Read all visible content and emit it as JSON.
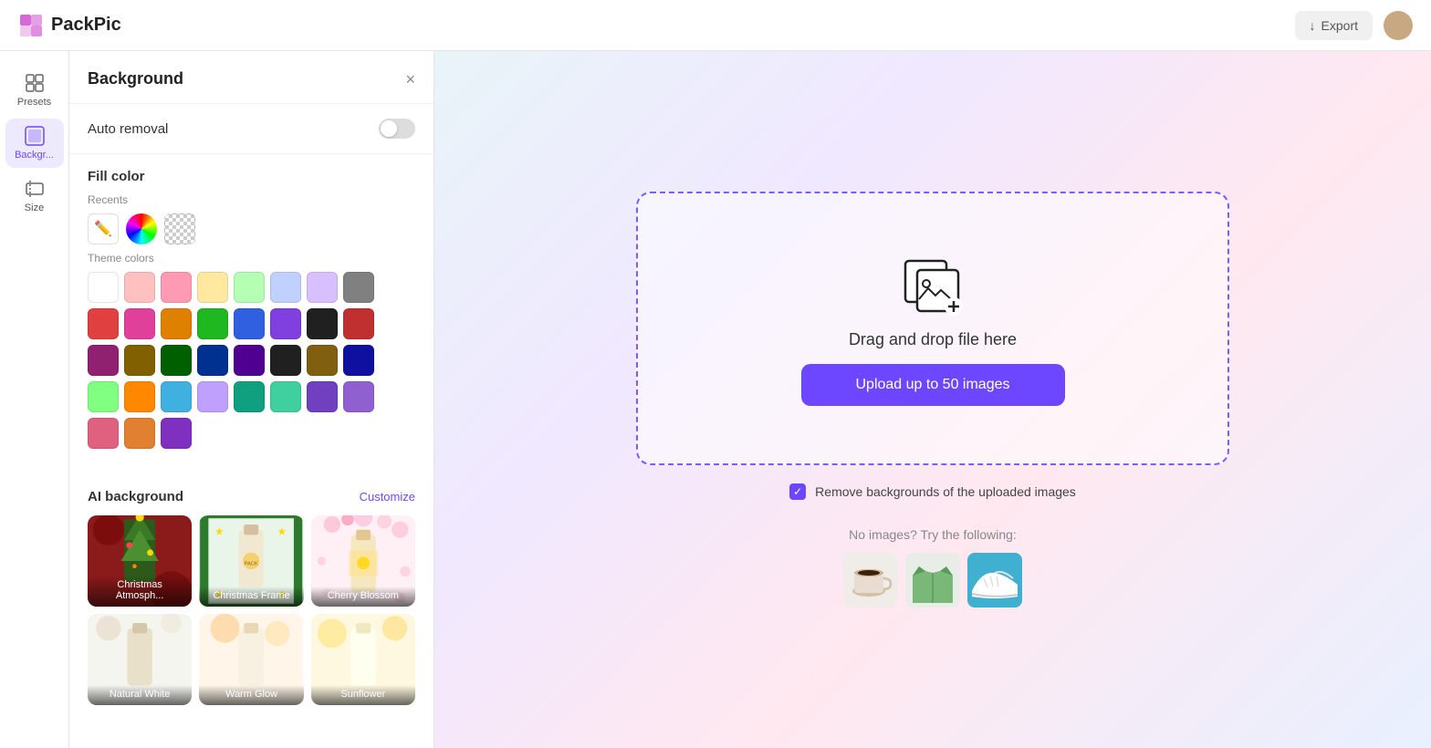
{
  "app": {
    "name": "PackPic",
    "logo_alt": "PackPic logo"
  },
  "header": {
    "export_label": "Export",
    "export_icon": "download-icon"
  },
  "sidebar": {
    "items": [
      {
        "id": "presets",
        "label": "Presets",
        "active": false
      },
      {
        "id": "background",
        "label": "Backgr...",
        "active": true
      },
      {
        "id": "size",
        "label": "Size",
        "active": false
      }
    ]
  },
  "panel": {
    "title": "Background",
    "close_label": "×",
    "auto_removal": {
      "label": "Auto removal",
      "enabled": false
    },
    "fill_color": {
      "title": "Fill color",
      "recents_label": "Recents",
      "theme_colors_label": "Theme colors"
    },
    "ai_background": {
      "title": "AI background",
      "customize_label": "Customize",
      "items": [
        {
          "id": "christmas-atmosph",
          "label": "Christmas Atmosph..."
        },
        {
          "id": "christmas-frame",
          "label": "Christmas Frame"
        },
        {
          "id": "cherry-blossom",
          "label": "Cherry Blossom"
        }
      ]
    }
  },
  "theme_colors": [
    "#ffffff",
    "#ffc0c0",
    "#ff9ab5",
    "#ffe9a0",
    "#b4ffb4",
    "#c0d0ff",
    "#d8c0ff",
    "#808080",
    "#e04040",
    "#e0409a",
    "#e08000",
    "#20b820",
    "#3060e0",
    "#8040e0",
    "#202020",
    "#c03030",
    "#902070",
    "#806000",
    "#006000",
    "#003090",
    "#500090",
    "#202020",
    "#806010",
    "#1010a0",
    "#80ff80",
    "#ff8800",
    "#40b0e0",
    "#c0a0ff",
    "#10a080",
    "#40d0a0",
    "#7040c0",
    "#9060d0",
    "#e06080",
    "#e08030",
    "#8030c0"
  ],
  "canvas": {
    "drag_drop_text": "Drag and drop file here",
    "upload_btn_label": "Upload up to 50 images",
    "checkbox_label": "Remove backgrounds of the uploaded images",
    "no_images_text": "No images? Try the following:"
  }
}
